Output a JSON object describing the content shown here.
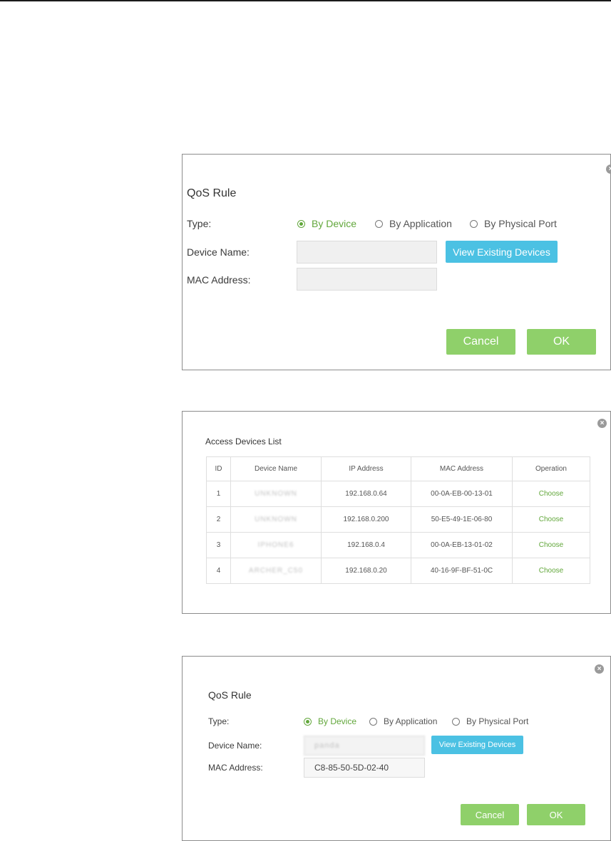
{
  "panel1": {
    "title": "QoS Rule",
    "type_label": "Type:",
    "radio_options": [
      "By Device",
      "By Application",
      "By Physical Port"
    ],
    "selected_option": "By Device",
    "device_name_label": "Device Name:",
    "device_name_value": "",
    "mac_label": "MAC Address:",
    "mac_value": "",
    "view_button": "View Existing Devices",
    "cancel": "Cancel",
    "ok": "OK"
  },
  "panel2": {
    "title": "Access Devices List",
    "columns": [
      "ID",
      "Device Name",
      "IP Address",
      "MAC Address",
      "Operation"
    ],
    "rows": [
      {
        "id": "1",
        "name": "UNKNOWN",
        "ip": "192.168.0.64",
        "mac": "00-0A-EB-00-13-01",
        "op": "Choose"
      },
      {
        "id": "2",
        "name": "UNKNOWN",
        "ip": "192.168.0.200",
        "mac": "50-E5-49-1E-06-80",
        "op": "Choose"
      },
      {
        "id": "3",
        "name": "IPHONE6",
        "ip": "192.168.0.4",
        "mac": "00-0A-EB-13-01-02",
        "op": "Choose"
      },
      {
        "id": "4",
        "name": "ARCHER_C50",
        "ip": "192.168.0.20",
        "mac": "40-16-9F-BF-51-0C",
        "op": "Choose"
      }
    ]
  },
  "panel3": {
    "title": "QoS Rule",
    "type_label": "Type:",
    "radio_options": [
      "By Device",
      "By Application",
      "By Physical Port"
    ],
    "selected_option": "By Device",
    "device_name_label": "Device Name:",
    "device_name_value": "panda",
    "mac_label": "MAC Address:",
    "mac_value": "C8-85-50-5D-02-40",
    "view_button": "View Existing Devices",
    "cancel": "Cancel",
    "ok": "OK"
  },
  "colors": {
    "accent_green": "#62a73b",
    "button_green": "#8fd06a",
    "button_blue": "#4bc1e3"
  },
  "icons": {
    "close": "close-circle-icon",
    "radio": "radio-icon"
  }
}
